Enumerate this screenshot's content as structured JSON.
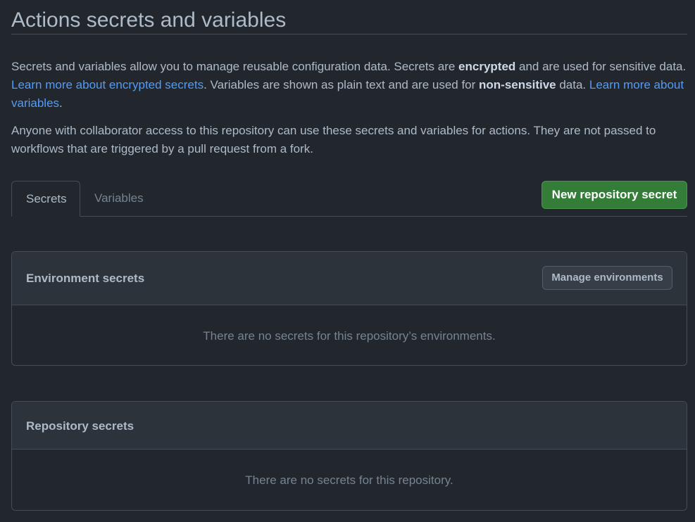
{
  "page": {
    "title": "Actions secrets and variables"
  },
  "intro": {
    "t1": "Secrets and variables allow you to manage reusable configuration data. Secrets are ",
    "b1": "encrypted",
    "t2": " and are used for sensitive data. ",
    "link1": "Learn more about encrypted secrets",
    "t3": ". Variables are shown as plain text and are used for ",
    "b2": "non-sensitive",
    "t4": " data. ",
    "link2": "Learn more about variables",
    "t5": "."
  },
  "notice": "Anyone with collaborator access to this repository can use these secrets and variables for actions. They are not passed to workflows that are triggered by a pull request from a fork.",
  "tabs": [
    {
      "label": "Secrets",
      "active": true
    },
    {
      "label": "Variables",
      "active": false
    }
  ],
  "actions": {
    "new_secret_label": "New repository secret"
  },
  "environment_secrets": {
    "title": "Environment secrets",
    "button_label": "Manage environments",
    "empty_text": "There are no secrets for this repository’s environments."
  },
  "repository_secrets": {
    "title": "Repository secrets",
    "empty_text": "There are no secrets for this repository."
  },
  "colors": {
    "background": "#22272e",
    "link": "#539bf5",
    "primary_button": "#347d39"
  }
}
